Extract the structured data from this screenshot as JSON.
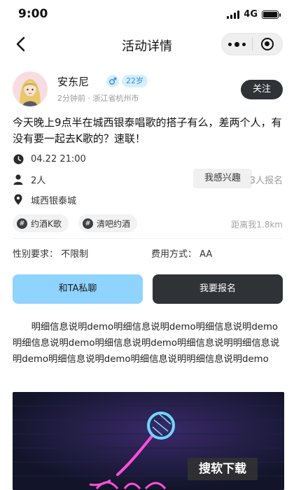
{
  "status_bar": {
    "time": "9:00",
    "network": "4G"
  },
  "nav": {
    "title": "活动详情"
  },
  "user": {
    "name": "安东尼",
    "age": "22岁",
    "time_ago": "2分钟前",
    "location": "浙江省杭州市",
    "follow_label": "关注"
  },
  "post": {
    "description": "今天晚上9点半在城西银泰唱歌的搭子有么，差两个人，有没有要一起去K歌的？速联！",
    "datetime": "04.22  21:00",
    "people": "2人",
    "interest_label": "我感兴趣",
    "signup_count": "3人报名",
    "venue": "城西银泰城"
  },
  "tags": [
    "约酒K歌",
    "清吧约酒"
  ],
  "distance": "距离我1.8km",
  "requirements": {
    "gender": "性别要求：  不限制",
    "fee": "费用方式：  AA"
  },
  "actions": {
    "chat_label": "和TA私聊",
    "join_label": "我要报名"
  },
  "detail_text": "明细信息说明demo明细信息说明demo明细信息说明demo明细信息说明demo明细信息说明demo明细信息说明明细信息说明demo明细信息说明demo明细信息说明明细信息说明demo",
  "banner": {
    "watermark": "搜软下载"
  },
  "colors": {
    "dark_button": "#2f3237",
    "light_blue_button": "#8fd3ff",
    "badge_bg": "#d7eefe",
    "badge_text": "#2a8fe6"
  },
  "icons": [
    "signal-icon",
    "battery-icon",
    "back-icon",
    "more-icon",
    "close-target-icon",
    "male-icon",
    "clock-icon",
    "people-icon",
    "location-icon",
    "hashtag-icon",
    "microphone-icon"
  ]
}
